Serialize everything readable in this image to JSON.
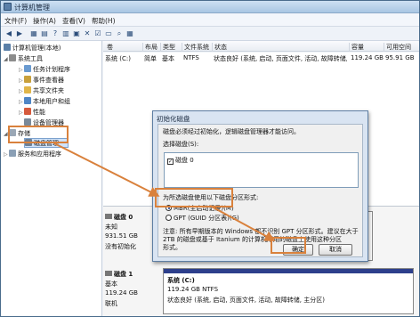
{
  "window": {
    "title": "计算机管理"
  },
  "menu": [
    "文件(F)",
    "操作(A)",
    "查看(V)",
    "帮助(H)"
  ],
  "tree": {
    "root": "计算机管理(本地)",
    "items": [
      {
        "label": "系统工具"
      },
      {
        "label": "任务计划程序"
      },
      {
        "label": "事件查看器"
      },
      {
        "label": "共享文件夹"
      },
      {
        "label": "本地用户和组"
      },
      {
        "label": "性能"
      },
      {
        "label": "设备管理器"
      },
      {
        "label": "存储"
      },
      {
        "label": "磁盘管理"
      },
      {
        "label": "服务和应用程序"
      }
    ]
  },
  "grid": {
    "headers": [
      "卷",
      "布局",
      "类型",
      "文件系统",
      "状态",
      "容量",
      "可用空间"
    ],
    "row": [
      "系统 (C:)",
      "简单",
      "基本",
      "NTFS",
      "状态良好 (系统, 启动, 页面文件, 活动, 故障转储, 主分区)",
      "119.24 GB",
      "95.91 GB"
    ]
  },
  "disks": [
    {
      "name": "磁盘 0",
      "type": "未知",
      "size": "931.51 GB",
      "status": "没有初始化"
    },
    {
      "name": "磁盘 1",
      "type": "基本",
      "size": "119.24 GB",
      "status": "联机",
      "part_name": "系统 (C:)",
      "part_size": "119.24 GB NTFS",
      "part_status": "状态良好 (系统, 启动, 页面文件, 活动, 故障转储, 主分区)"
    }
  ],
  "dialog": {
    "title": "初始化磁盘",
    "intro": "磁盘必须经过初始化，逻辑磁盘管理器才能访问。",
    "select_label": "选择磁盘(S):",
    "disk_item": "磁盘 0",
    "style_label": "为所选磁盘使用以下磁盘分区形式:",
    "mbr": "MBR(主启动记录)(M)",
    "gpt": "GPT (GUID 分区表)(G)",
    "note1": "注意: 所有早期版本的 Windows 都不识别 GPT 分区形式。建议在大于",
    "note2": "2TB 的磁盘或基于 Itanium 的计算机所用的磁盘上使用这种分区",
    "note3": "形式。",
    "ok": "确定",
    "cancel": "取消"
  },
  "colors": {
    "highlight": "#d9813c",
    "partition_cap": "#2d3f8c"
  }
}
